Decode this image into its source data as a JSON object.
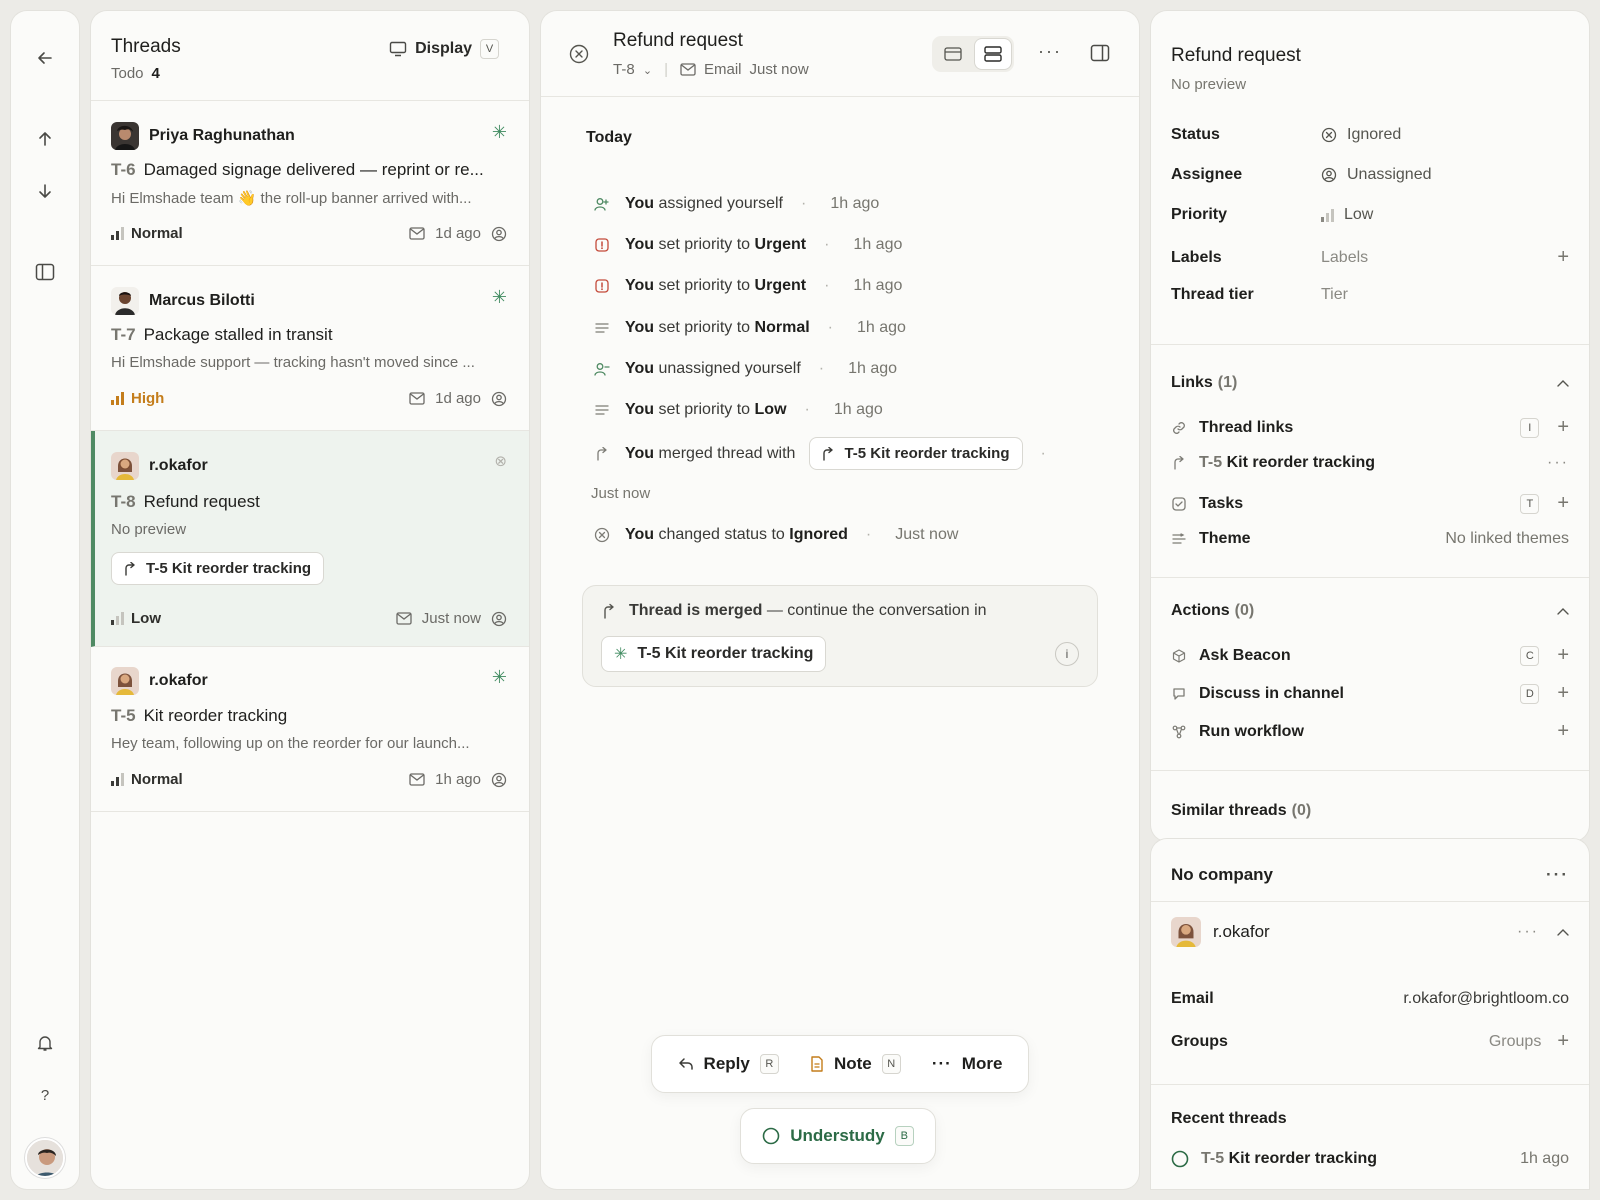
{
  "threads": {
    "title": "Threads",
    "filter_label": "Todo",
    "filter_count": "4",
    "display_label": "Display",
    "display_key": "V",
    "items": [
      {
        "author": "Priya Raghunathan",
        "id": "T-6",
        "title": "Damaged signage delivered — reprint or re...",
        "preview": "Hi Elmshade team 👋 the roll-up banner arrived with...",
        "priority": "Normal",
        "time": "1d ago"
      },
      {
        "author": "Marcus Bilotti",
        "id": "T-7",
        "title": "Package stalled in transit",
        "preview": "Hi Elmshade support — tracking hasn't moved since ...",
        "priority": "High",
        "time": "1d ago"
      },
      {
        "author": "r.okafor",
        "id": "T-8",
        "title": "Refund request",
        "preview": "No preview",
        "link_chip": "T-5 Kit reorder tracking",
        "priority": "Low",
        "time": "Just now"
      },
      {
        "author": "r.okafor",
        "id": "T-5",
        "title": "Kit reorder tracking",
        "preview": "Hey team, following up on the reorder for our launch...",
        "priority": "Normal",
        "time": "1h ago"
      }
    ]
  },
  "conversation": {
    "title": "Refund request",
    "id": "T-8",
    "channel": "Email",
    "time": "Just now",
    "day_label": "Today",
    "events": [
      {
        "actor": "You",
        "text": "assigned yourself",
        "bold": "",
        "when": "1h ago"
      },
      {
        "actor": "You",
        "text": "set priority to",
        "bold": "Urgent",
        "when": "1h ago"
      },
      {
        "actor": "You",
        "text": "set priority to",
        "bold": "Urgent",
        "when": "1h ago"
      },
      {
        "actor": "You",
        "text": "set priority to",
        "bold": "Normal",
        "when": "1h ago"
      },
      {
        "actor": "You",
        "text": "unassigned yourself",
        "bold": "",
        "when": "1h ago"
      },
      {
        "actor": "You",
        "text": "set priority to",
        "bold": "Low",
        "when": "1h ago"
      },
      {
        "actor": "You",
        "text": "merged thread with",
        "bold": "",
        "when": ""
      },
      {
        "actor": "You",
        "text": "changed status to",
        "bold": "Ignored",
        "when": "Just now"
      }
    ],
    "merge_chip": "T-5 Kit reorder tracking",
    "merge_time": "Just now",
    "merged_notice_bold": "Thread is merged",
    "merged_notice_rest": "— continue the conversation in",
    "merged_chip": "T-5 Kit reorder tracking",
    "merged_info": "i",
    "composer": {
      "reply": "Reply",
      "reply_key": "R",
      "note": "Note",
      "note_key": "N",
      "more": "More"
    },
    "understudy": "Understudy",
    "understudy_key": "B"
  },
  "details": {
    "title": "Refund request",
    "subtitle": "No preview",
    "props": {
      "status_k": "Status",
      "status_v": "Ignored",
      "assignee_k": "Assignee",
      "assignee_v": "Unassigned",
      "priority_k": "Priority",
      "priority_v": "Low",
      "labels_k": "Labels",
      "labels_v": "Labels",
      "tier_k": "Thread tier",
      "tier_v": "Tier"
    },
    "links": {
      "title": "Links",
      "count": "(1)",
      "thread_links": "Thread links",
      "thread_links_key": "I",
      "linked_id": "T-5",
      "linked_title": "Kit reorder tracking",
      "tasks": "Tasks",
      "tasks_key": "T",
      "theme": "Theme",
      "theme_v": "No linked themes"
    },
    "actions": {
      "title": "Actions",
      "count": "(0)",
      "ask": "Ask Beacon",
      "ask_key": "C",
      "discuss": "Discuss in channel",
      "discuss_key": "D",
      "workflow": "Run workflow"
    },
    "similar": {
      "title": "Similar threads",
      "count": "(0)"
    }
  },
  "contact": {
    "company": "No company",
    "name": "r.okafor",
    "email_k": "Email",
    "email_v": "r.okafor@brightloom.co",
    "groups_k": "Groups",
    "groups_v": "Groups",
    "recent_title": "Recent threads",
    "recent_id": "T-5",
    "recent_title_text": "Kit reorder tracking",
    "recent_time": "1h ago"
  },
  "colors": {
    "accent": "#4f8a63",
    "high": "#c47d1b",
    "urgent": "#c44a3a"
  }
}
